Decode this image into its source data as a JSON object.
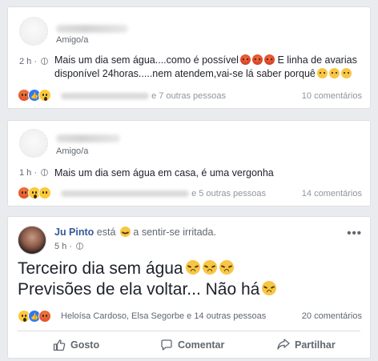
{
  "posts": [
    {
      "relation": "Amigo/a",
      "time": "2 h",
      "text": "Mais um dia sem água....como é possível",
      "text_line2": "E linha de avarias disponível 24horas.....nem atendem,vai-se lá saber porquê",
      "others": "e 7 outras pessoas",
      "comments": "10 comentários"
    },
    {
      "relation": "Amigo/a",
      "time": "1 h",
      "text": "Mais um dia sem água em casa, é uma vergonha",
      "others": "e 5 outras pessoas",
      "comments": "14 comentários"
    },
    {
      "author": "Ju Pinto",
      "feeling_pre": "está",
      "feeling": "a sentir-se irritada.",
      "time": "5 h",
      "line1": "Terceiro dia sem água",
      "line2": "Previsões de ela voltar... Não há",
      "likers": "Heloísa Cardoso, Elsa Segorbe e 14 outras pessoas",
      "comments": "20 comentários",
      "actions": {
        "like": "Gosto",
        "comment": "Comentar",
        "share": "Partilhar"
      },
      "menu": "•••"
    }
  ],
  "icons": [
    "globe-icon",
    "angry-emoji",
    "confused-emoji",
    "frustrated-emoji",
    "like-icon",
    "comment-icon",
    "share-icon"
  ]
}
